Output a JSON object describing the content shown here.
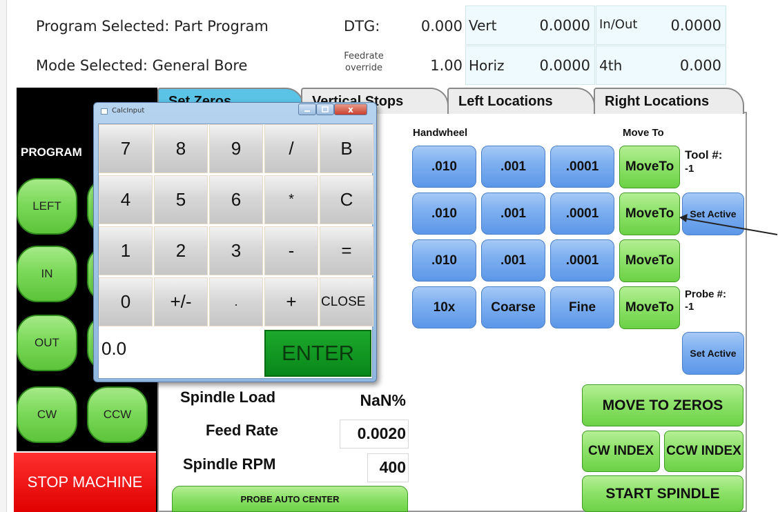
{
  "header": {
    "program_selected": "Program Selected: Part Program",
    "mode_selected": "Mode Selected: General Bore",
    "dtg_label": "DTG:",
    "dtg_value": "0.000",
    "feedrate_override_label": "Feedrate override",
    "feedrate_override_value": "1.00",
    "vert_label": "Vert",
    "vert_value": "0.0000",
    "horiz_label": "Horiz",
    "horiz_value": "0.0000",
    "inout_label": "In/Out",
    "inout_value": "0.0000",
    "fourth_label": "4th",
    "fourth_value": "0.000"
  },
  "left_panel": {
    "program_label": "PROGRAM",
    "buttons": {
      "left": "LEFT",
      "in": "IN",
      "out": "OUT",
      "cw": "CW",
      "ccw": "CCW"
    },
    "stop": "STOP MACHINE"
  },
  "tabs": [
    "Set Zeros",
    "Vertical Stops",
    "Left Locations",
    "Right Locations"
  ],
  "panel": {
    "handwheel_label": "Handwheel",
    "move_to_label": "Move To",
    "rows": [
      [
        ".010",
        ".001",
        ".0001"
      ],
      [
        ".010",
        ".001",
        ".0001"
      ],
      [
        ".010",
        ".001",
        ".0001"
      ],
      [
        "10x",
        "Coarse",
        "Fine"
      ]
    ],
    "move_to_button": "MoveTo",
    "tool_label": "Tool #:",
    "tool_value": "-1",
    "probe_label": "Probe #:",
    "probe_value": "-1",
    "set_active": "Set Active",
    "spindle_load_label": "Spindle Load",
    "spindle_load_value": "NaN%",
    "feed_rate_label": "Feed Rate",
    "feed_rate_value": "0.0020",
    "spindle_rpm_label": "Spindle RPM",
    "spindle_rpm_value": "400",
    "probe_auto_center": "PROBE AUTO CENTER",
    "move_to_zeros": "MOVE TO ZEROS",
    "cw_index": "CW INDEX",
    "ccw_index": "CCW INDEX",
    "start_spindle": "START SPINDLE"
  },
  "calc": {
    "title": "CalcInput",
    "keys": [
      [
        "7",
        "8",
        "9",
        "/",
        "B"
      ],
      [
        "4",
        "5",
        "6",
        "*",
        "C"
      ],
      [
        "1",
        "2",
        "3",
        "-",
        "="
      ],
      [
        "0",
        "+/-",
        ".",
        "+",
        "CLOSE"
      ]
    ],
    "display_value": "0.0",
    "enter": "ENTER",
    "window_close_glyph": "x"
  }
}
